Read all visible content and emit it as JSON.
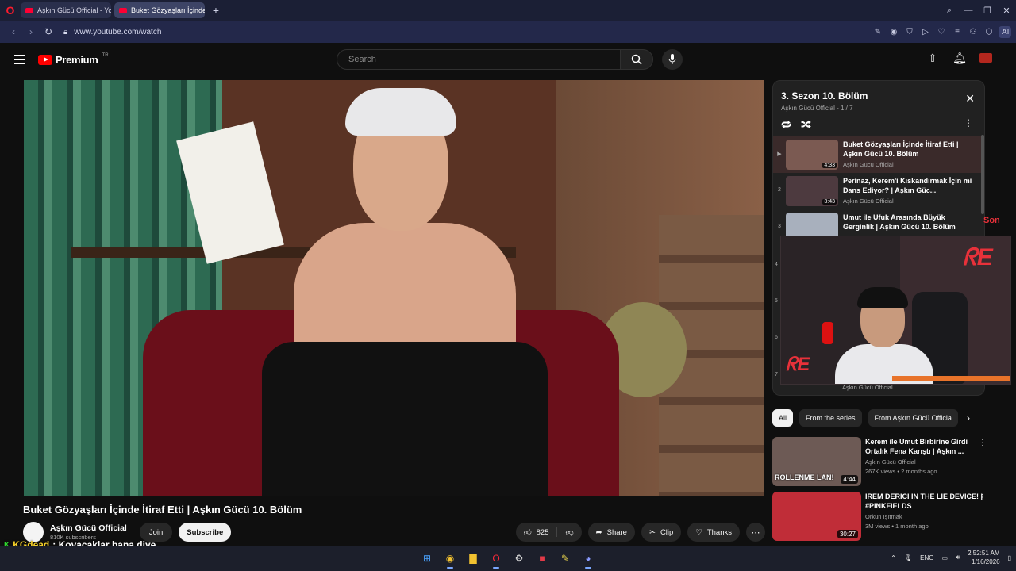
{
  "browser": {
    "tabs": [
      {
        "label": "Aşkın Gücü Official - YouT"
      },
      {
        "label": "Buket Gözyaşları İçinde İt"
      }
    ],
    "url": "www.youtube.com/watch",
    "ai_label": "AI"
  },
  "header": {
    "logo_text": "Premium",
    "logo_region": "TR",
    "search_placeholder": "Search"
  },
  "video": {
    "title": "Buket Gözyaşları İçinde İtiraf Etti | Aşkın Gücü 10. Bölüm",
    "channel": "Aşkın Gücü Official",
    "subscribers": "810K subscribers",
    "join_label": "Join",
    "subscribe_label": "Subscribe",
    "likes": "825",
    "share_label": "Share",
    "clip_label": "Clip",
    "thanks_label": "Thanks"
  },
  "playlist": {
    "title": "3. Sezon 10. Bölüm",
    "subtitle": "Aşkın Gücü Official - 1 / 7",
    "items": [
      {
        "index": "▶",
        "title": "Buket Gözyaşları İçinde İtiraf Etti | Aşkın Gücü 10. Bölüm",
        "channel": "Aşkın Gücü Official",
        "duration": "4:33",
        "thumb_color": "#7b5a52"
      },
      {
        "index": "2",
        "title": "Perinaz, Kerem'i Kıskandırmak İçin mi Dans Ediyor? | Aşkın Güc...",
        "channel": "Aşkın Gücü Official",
        "duration": "3:43",
        "thumb_color": "#4d3a3f"
      },
      {
        "index": "3",
        "title": "Umut ile Ufuk Arasında Büyük Gerginlik | Aşkın Gücü 10. Bölüm",
        "channel": "",
        "duration": "",
        "thumb_color": "#a8b0bd"
      }
    ],
    "hidden_indices": [
      "4",
      "5",
      "6",
      "7"
    ],
    "last_channel": "Aşkın Gücü Official"
  },
  "overlay": {
    "son_text": "Son"
  },
  "chips": [
    "All",
    "From the series",
    "From Aşkın Gücü Officia"
  ],
  "recommendations": [
    {
      "title": "Kerem ile Umut Birbirine Girdi Ortalık Fena Karıştı | Aşkın ...",
      "channel": "Aşkın Gücü Official",
      "meta": "267K views • 2 months ago",
      "duration": "4:44",
      "tag": "ROLLENME LAN!",
      "thumb_color": "#6d5a55"
    },
    {
      "title": "IREM DERICI IN THE LIE DEVICE! | #PINKFIELDS",
      "channel": "Orkun Işıtmak",
      "meta": "3M views • 1 month ago",
      "duration": "30:27",
      "tag": "",
      "thumb_color": "#c02d38"
    }
  ],
  "chat": {
    "user": "KGdead",
    "message": ": Koyacaklar bana diye"
  },
  "taskbar": {
    "lang": "ENG",
    "time": "2:52:51 AM",
    "date": "1/16/2026"
  }
}
